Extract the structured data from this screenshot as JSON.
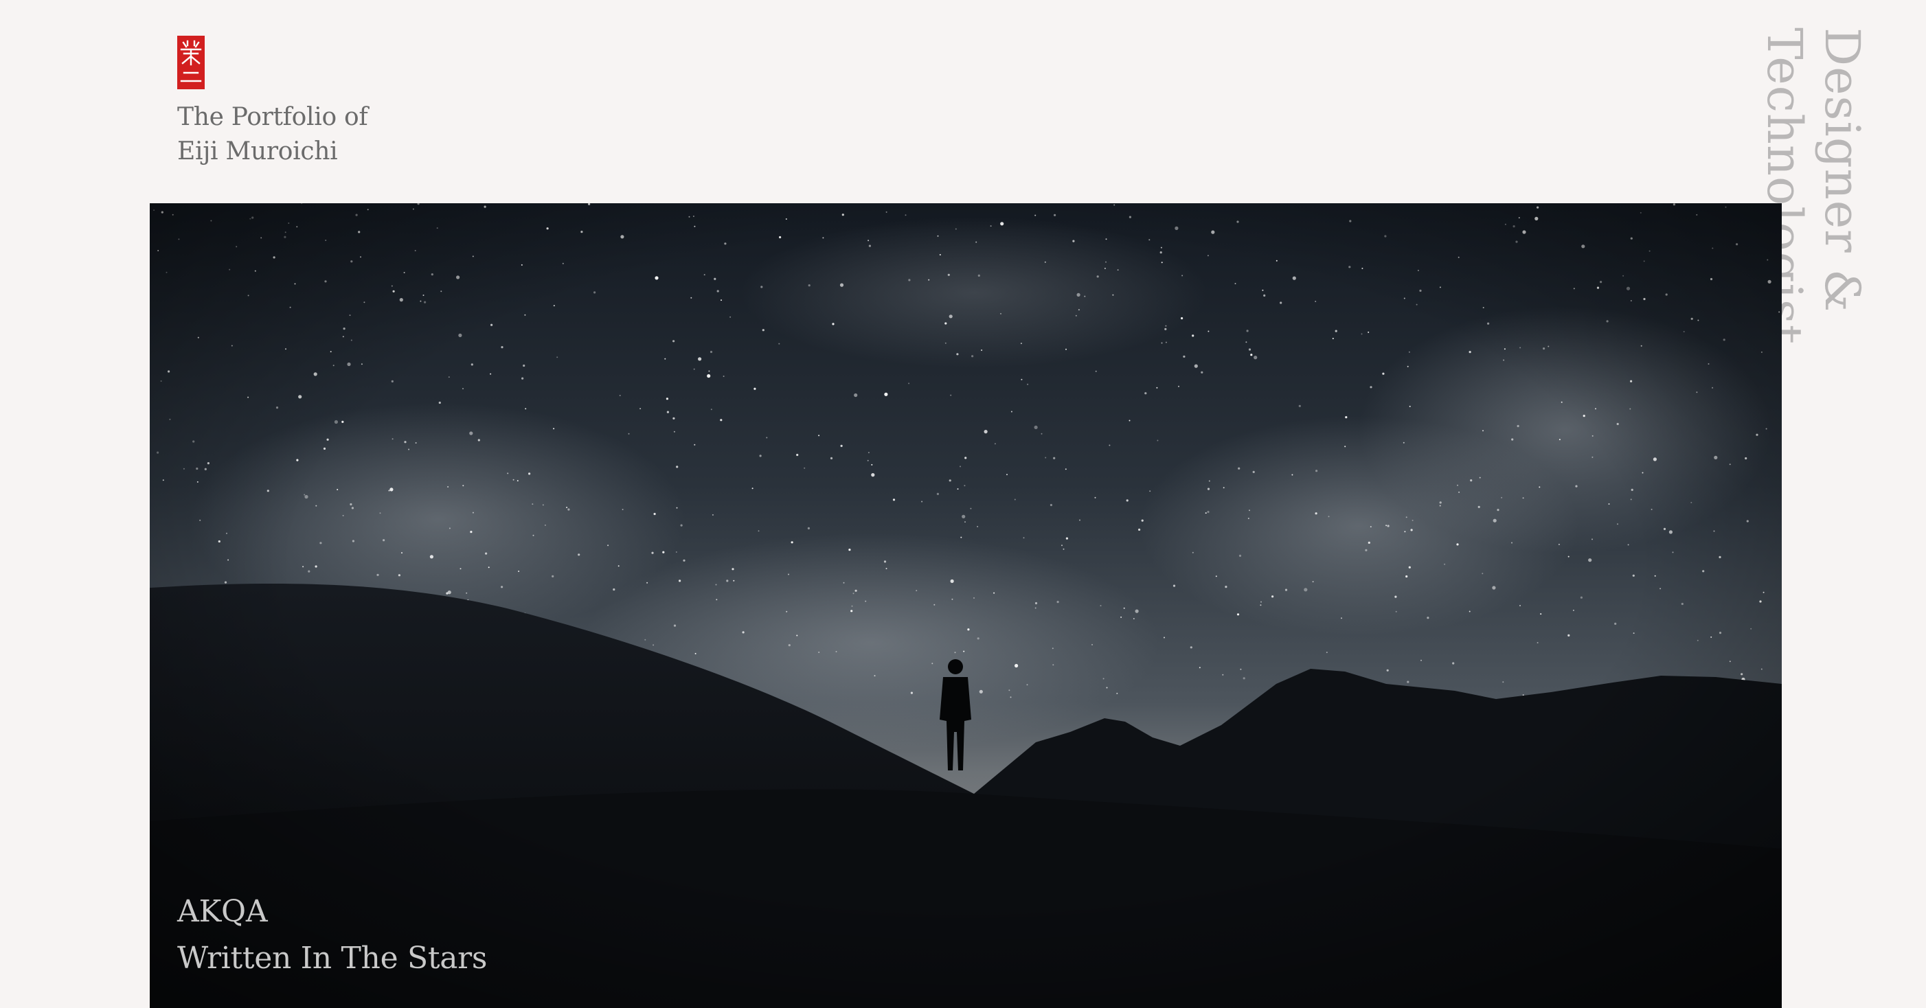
{
  "logo": {
    "icon": "red-seal-icon",
    "color": "#d21f1f"
  },
  "header": {
    "portfolio_line1": "The Portfolio of",
    "portfolio_line2": "Eiji Muroichi"
  },
  "tagline": {
    "line1": "Designer &",
    "line2": "Technologist"
  },
  "hero": {
    "image": "night-sky-silhouette",
    "client": "AKQA",
    "project_title": "Written In The Stars"
  }
}
